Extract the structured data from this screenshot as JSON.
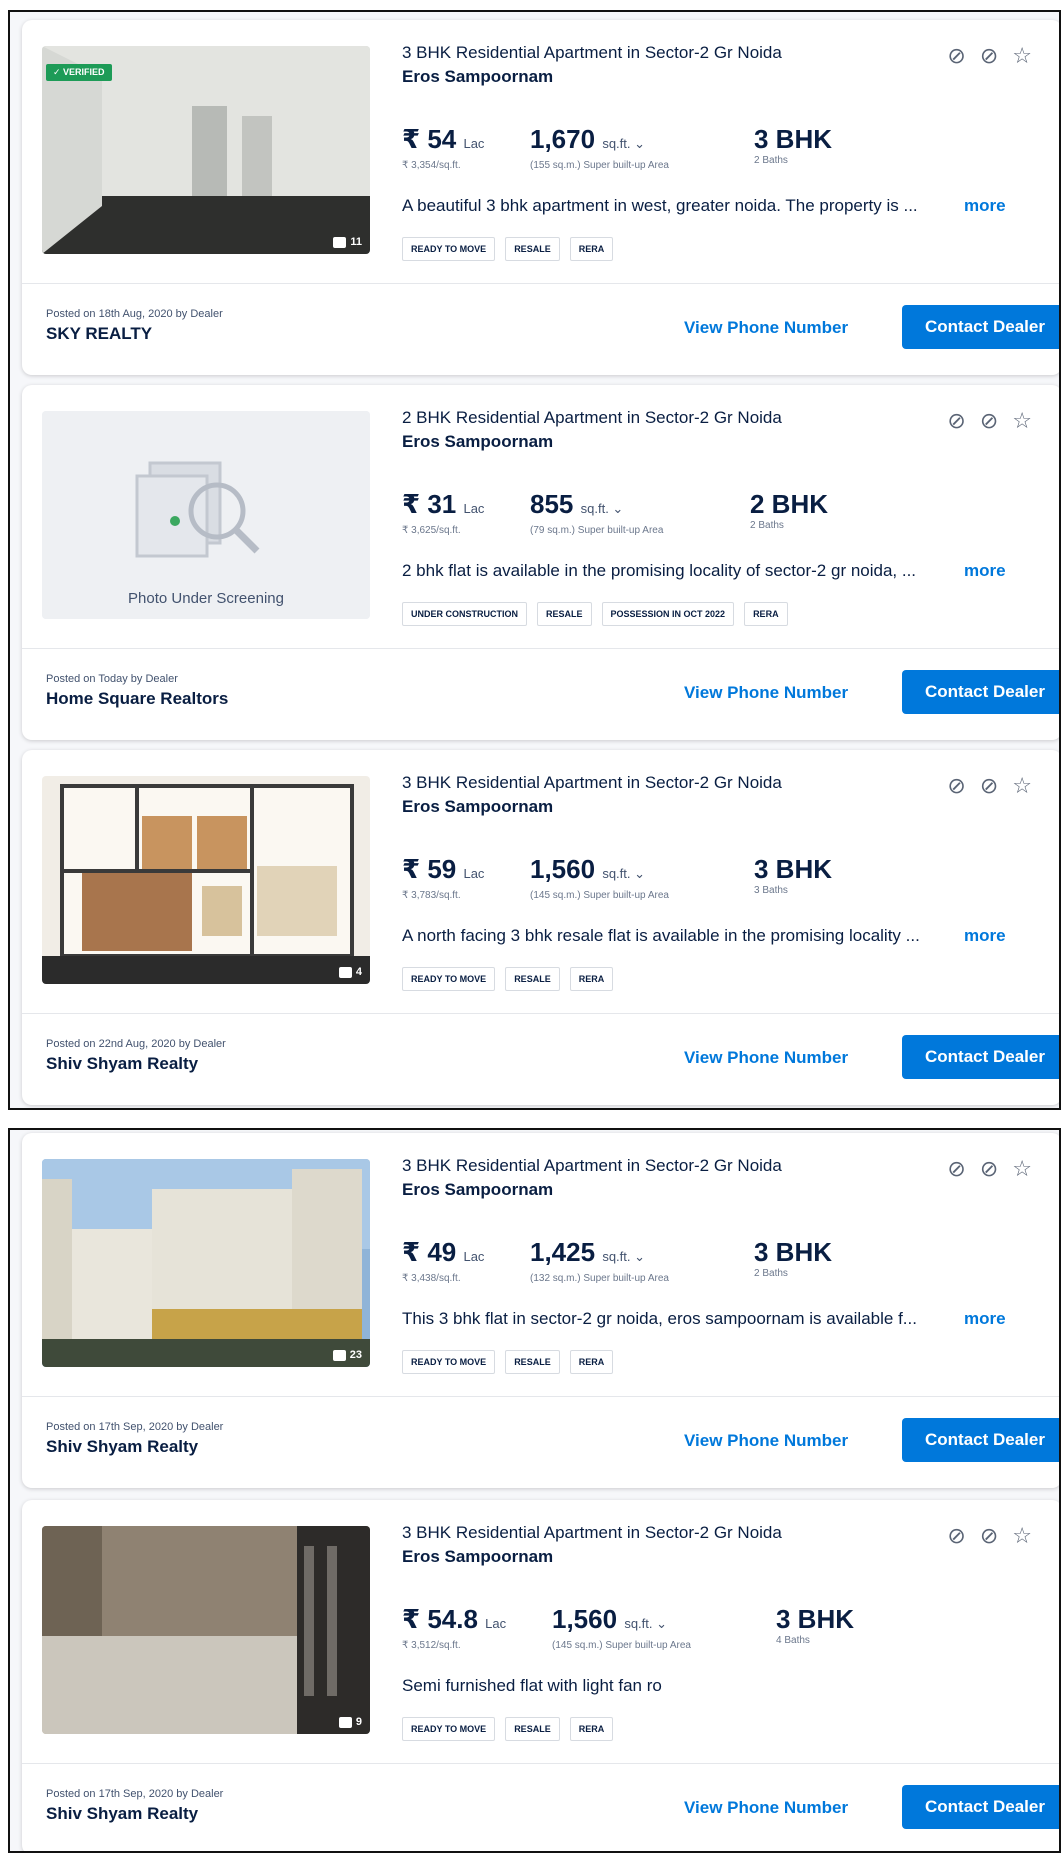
{
  "listings": [
    {
      "title": "3 BHK Residential Apartment in Sector-2 Gr Noida",
      "project": "Eros Sampoornam",
      "price": "₹ 54",
      "price_unit": "Lac",
      "price_per_sqft": "₹ 3,354/sq.ft.",
      "area": "1,670",
      "area_unit": "sq.ft. ⌄",
      "area_sub": "(155 sq.m.) Super built-up Area",
      "config": "3 BHK",
      "baths": "2 Baths",
      "description": "A beautiful 3 bhk apartment in west, greater noida. The property is ...",
      "more": "more",
      "tags": [
        "READY TO MOVE",
        "RESALE",
        "RERA"
      ],
      "posted": "Posted on 18th Aug, 2020 by Dealer",
      "dealer": "SKY REALTY",
      "photo_count": "11",
      "verified": "✓ VERIFIED"
    },
    {
      "title": "2 BHK Residential Apartment in Sector-2 Gr Noida",
      "project": "Eros Sampoornam",
      "price": "₹ 31",
      "price_unit": "Lac",
      "price_per_sqft": "₹ 3,625/sq.ft.",
      "area": "855",
      "area_unit": "sq.ft. ⌄",
      "area_sub": "(79 sq.m.) Super built-up Area",
      "config": "2 BHK",
      "baths": "2 Baths",
      "description": "2 bhk flat is available in the promising locality of sector-2 gr noida, ...",
      "more": "more",
      "tags": [
        "UNDER CONSTRUCTION",
        "RESALE",
        "POSSESSION IN OCT 2022",
        "RERA"
      ],
      "posted": "Posted on Today by Dealer",
      "dealer": "Home Square Realtors",
      "screening": "Photo Under Screening"
    },
    {
      "title": "3 BHK Residential Apartment in Sector-2 Gr Noida",
      "project": "Eros Sampoornam",
      "price": "₹ 59",
      "price_unit": "Lac",
      "price_per_sqft": "₹ 3,783/sq.ft.",
      "area": "1,560",
      "area_unit": "sq.ft. ⌄",
      "area_sub": "(145 sq.m.) Super built-up Area",
      "config": "3 BHK",
      "baths": "3 Baths",
      "description": "A north facing 3 bhk resale flat is available in the promising locality ...",
      "more": "more",
      "tags": [
        "READY TO MOVE",
        "RESALE",
        "RERA"
      ],
      "posted": "Posted on 22nd Aug, 2020 by Dealer",
      "dealer": "Shiv Shyam Realty",
      "photo_count": "4"
    },
    {
      "title": "3 BHK Residential Apartment in Sector-2 Gr Noida",
      "project": "Eros Sampoornam",
      "price": "₹ 49",
      "price_unit": "Lac",
      "price_per_sqft": "₹ 3,438/sq.ft.",
      "area": "1,425",
      "area_unit": "sq.ft. ⌄",
      "area_sub": "(132 sq.m.) Super built-up Area",
      "config": "3 BHK",
      "baths": "2 Baths",
      "description": "This 3 bhk flat in sector-2 gr noida, eros sampoornam is available f...",
      "more": "more",
      "tags": [
        "READY TO MOVE",
        "RESALE",
        "RERA"
      ],
      "posted": "Posted on 17th Sep, 2020 by Dealer",
      "dealer": "Shiv Shyam Realty",
      "photo_count": "23"
    },
    {
      "title": "3 BHK Residential Apartment in Sector-2 Gr Noida",
      "project": "Eros Sampoornam",
      "price": "₹ 54.8",
      "price_unit": "Lac",
      "price_per_sqft": "₹ 3,512/sq.ft.",
      "area": "1,560",
      "area_unit": "sq.ft. ⌄",
      "area_sub": "(145 sq.m.) Super built-up Area",
      "config": "3 BHK",
      "baths": "4 Baths",
      "description": "Semi furnished flat with light fan ro",
      "more": "",
      "tags": [
        "READY TO MOVE",
        "RESALE",
        "RERA"
      ],
      "posted": "Posted on 17th Sep, 2020 by Dealer",
      "dealer": "Shiv Shyam Realty",
      "photo_count": "9"
    }
  ],
  "actions": {
    "view_phone": "View Phone Number",
    "contact": "Contact Dealer"
  },
  "icons": {
    "hide": "⊘",
    "not_interested": "eye-off-icon",
    "shortlist": "☆"
  },
  "colors": {
    "accent": "#0078db",
    "text": "#091E42",
    "verified": "#1d9b57"
  }
}
